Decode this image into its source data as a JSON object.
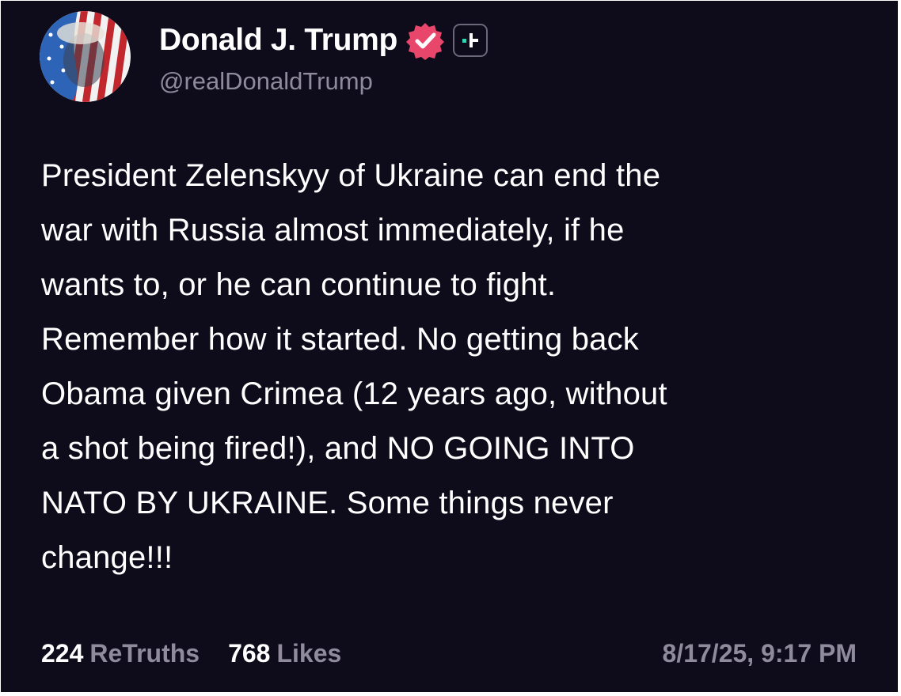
{
  "author": {
    "display_name": "Donald J. Trump",
    "handle": "@realDonaldTrump",
    "verified_icon": "verified-badge-icon",
    "plus_icon": "plus-badge-icon"
  },
  "post": {
    "text": "President Zelenskyy of Ukraine can end the\nwar with Russia almost immediately, if he\nwants to, or he can continue to fight.\nRemember how it started. No getting back\nObama given Crimea (12 years ago, without\na shot being fired!), and NO GOING INTO\nNATO BY UKRAINE. Some things never\nchange!!!"
  },
  "stats": {
    "retruths_count": "224",
    "retruths_label": "ReTruths",
    "likes_count": "768",
    "likes_label": "Likes"
  },
  "timestamp": "8/17/25, 9:17 PM",
  "colors": {
    "background": "#0e0b1b",
    "text": "#ffffff",
    "muted": "#8f8b9c",
    "verified": "#e8466a",
    "accent": "#33d6b4"
  }
}
